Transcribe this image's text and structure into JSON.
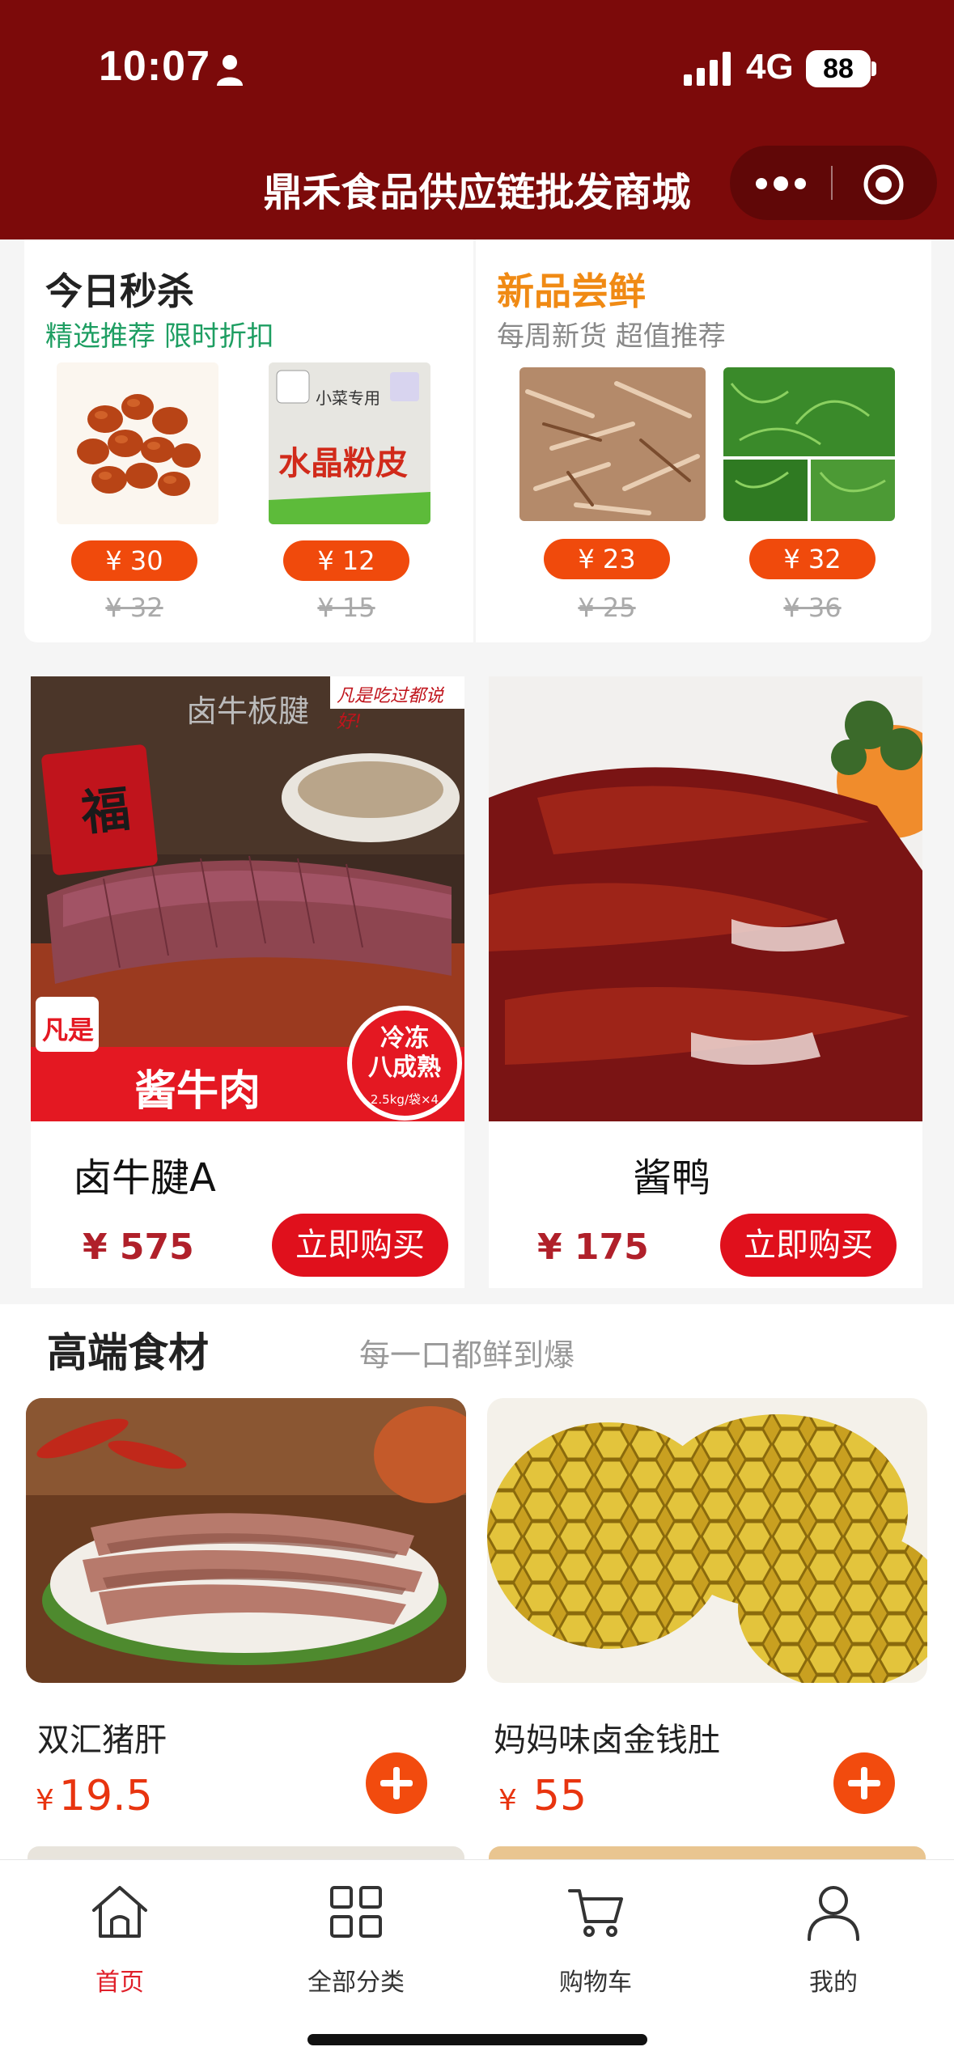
{
  "status_bar": {
    "time": "10:07",
    "network": "4G",
    "battery": "88"
  },
  "header": {
    "title": "鼎禾食品供应链批发商城"
  },
  "promos": [
    {
      "title": "今日秒杀",
      "subtitle": "精选推荐 限时折扣",
      "items": [
        {
          "price": "¥ 30",
          "old_price": "¥ 32"
        },
        {
          "price": "¥ 12",
          "old_price": "¥ 15",
          "package_text": "水晶粉皮",
          "brand_text": "小菜专用"
        }
      ]
    },
    {
      "title": "新品尝鲜",
      "subtitle": "每周新货 超值推荐",
      "items": [
        {
          "price": "¥ 23",
          "old_price": "¥ 25"
        },
        {
          "price": "¥ 32",
          "old_price": "¥ 36"
        }
      ]
    }
  ],
  "featured": [
    {
      "name": "卤牛腱A",
      "price": "¥ 575",
      "button": "立即购买",
      "image_caption": "卤牛板腱",
      "image_banner": "酱牛肉",
      "image_badge": "冷冻\n八成熟",
      "image_badge_small": "2.5kg/袋×4",
      "image_logo": "凡是",
      "image_slogan": "凡是吃过都说好!",
      "image_fu": "福"
    },
    {
      "name": "酱鸭",
      "price": "¥ 175",
      "button": "立即购买"
    }
  ],
  "premium": {
    "title": "高端食材",
    "subtitle": "每一口都鲜到爆",
    "items": [
      {
        "name": "双汇猪肝",
        "currency": "¥",
        "price": "19.5"
      },
      {
        "name": "妈妈味卤金钱肚",
        "currency": "¥",
        "price": "55"
      }
    ]
  },
  "tabbar": [
    {
      "label": "首页",
      "icon": "home-icon",
      "active": true
    },
    {
      "label": "全部分类",
      "icon": "grid-icon",
      "active": false
    },
    {
      "label": "购物车",
      "icon": "cart-icon",
      "active": false
    },
    {
      "label": "我的",
      "icon": "user-icon",
      "active": false
    }
  ],
  "colors": {
    "header_bg": "#7c0a0a",
    "accent_orange": "#f04a0c",
    "buy_red": "#e0101c",
    "active_tab": "#e0202a",
    "promo_subtitle_green": "#1e9e62"
  }
}
